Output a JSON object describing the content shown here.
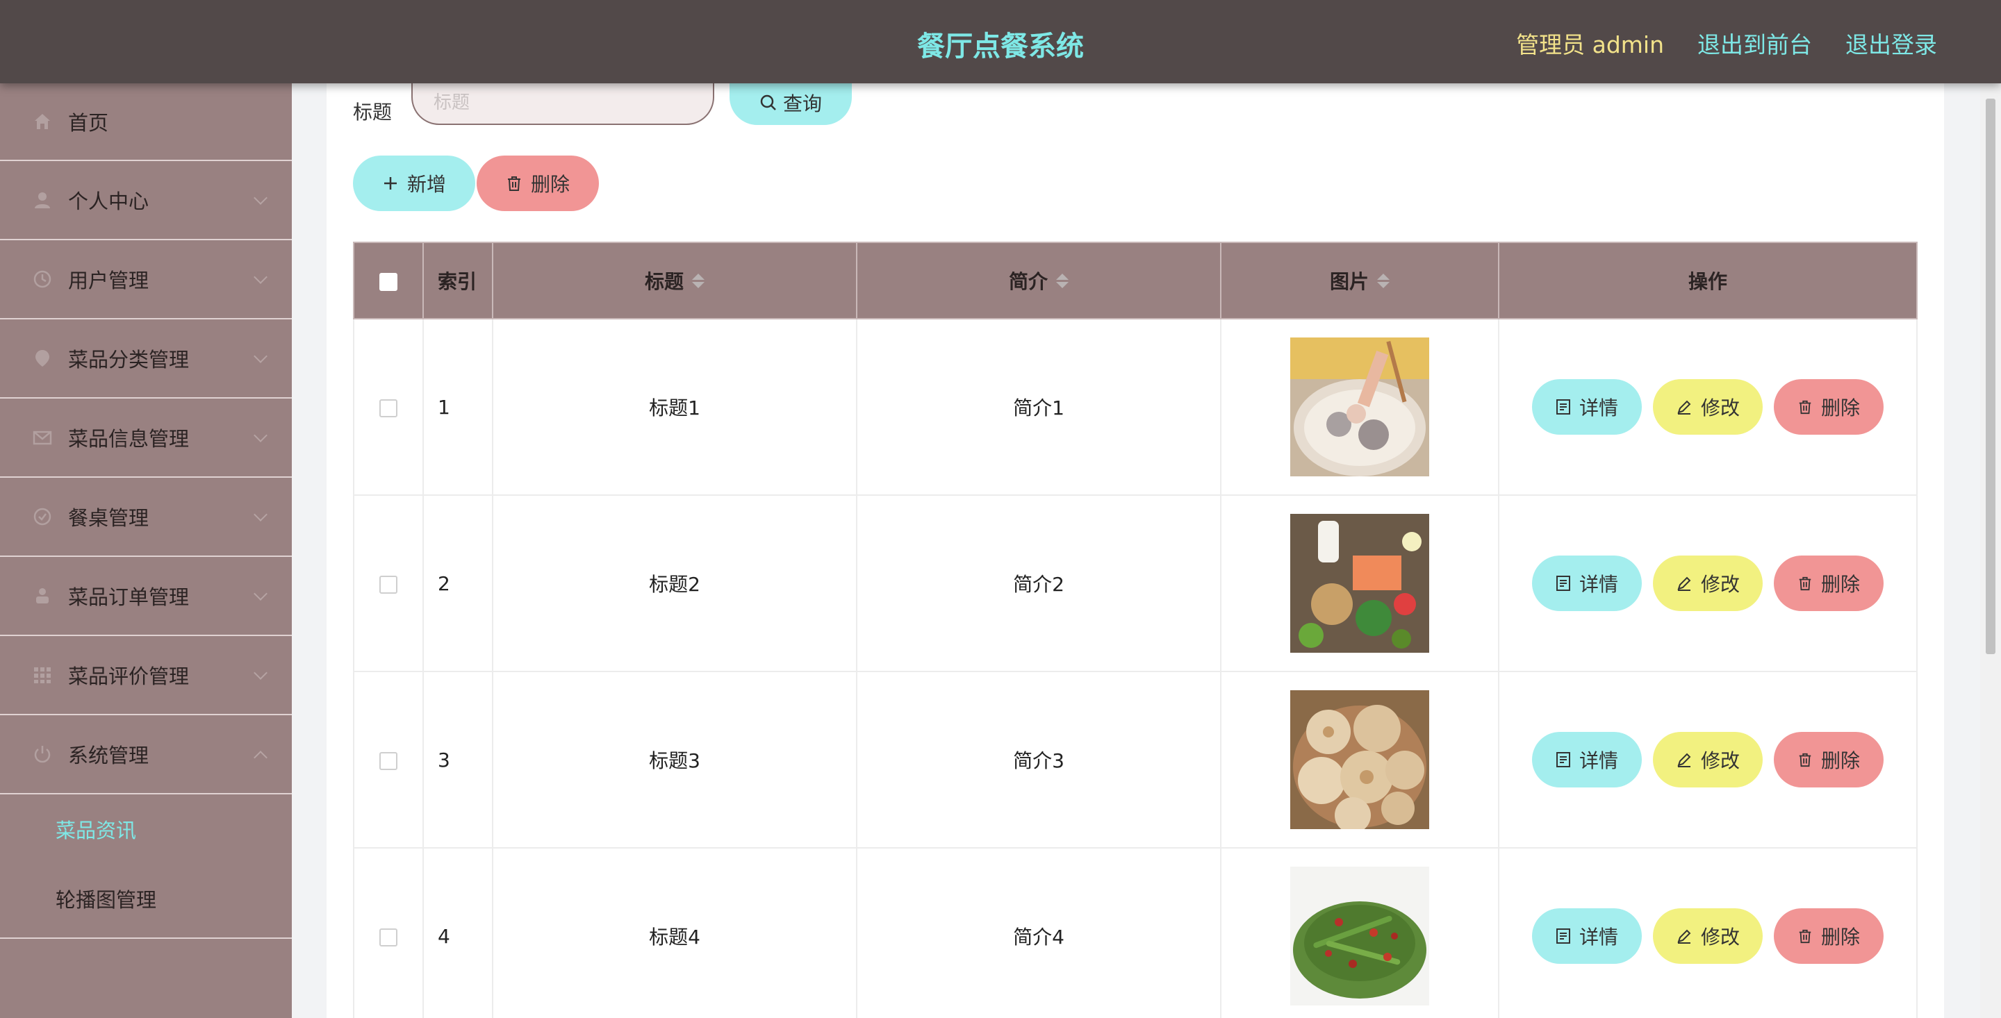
{
  "header": {
    "title": "餐厅点餐系统",
    "admin": "管理员 admin",
    "front_link": "退出到前台",
    "logout_link": "退出登录"
  },
  "sidebar": {
    "items": [
      {
        "label": "首页",
        "icon": "home-icon"
      },
      {
        "label": "个人中心",
        "icon": "user-icon"
      },
      {
        "label": "用户管理",
        "icon": "clock-icon"
      },
      {
        "label": "菜品分类管理",
        "icon": "location-icon"
      },
      {
        "label": "菜品信息管理",
        "icon": "mail-icon"
      },
      {
        "label": "餐桌管理",
        "icon": "check-circle-icon"
      },
      {
        "label": "菜品订单管理",
        "icon": "person-icon"
      },
      {
        "label": "菜品评价管理",
        "icon": "grid-icon"
      },
      {
        "label": "系统管理",
        "icon": "power-icon"
      }
    ],
    "submenu": [
      {
        "label": "菜品资讯",
        "active": true
      },
      {
        "label": "轮播图管理",
        "active": false
      }
    ]
  },
  "search": {
    "label": "标题",
    "placeholder": "标题",
    "button": "查询"
  },
  "actions": {
    "add": "新增",
    "delete": "删除"
  },
  "table": {
    "headers": {
      "index": "索引",
      "title": "标题",
      "intro": "简介",
      "image": "图片",
      "ops": "操作"
    },
    "rows": [
      {
        "index": "1",
        "title": "标题1",
        "intro": "简介1",
        "image": "hotpot-photo"
      },
      {
        "index": "2",
        "title": "标题2",
        "intro": "简介2",
        "image": "healthy-food-photo"
      },
      {
        "index": "3",
        "title": "标题3",
        "intro": "简介3",
        "image": "pastry-photo"
      },
      {
        "index": "4",
        "title": "标题4",
        "intro": "简介4",
        "image": "green-beans-photo"
      }
    ],
    "op_labels": {
      "detail": "详情",
      "edit": "修改",
      "delete": "删除"
    }
  },
  "colors": {
    "header_bg": "#524949",
    "sidebar_bg": "#998181",
    "accent_cyan": "#a4eeee",
    "accent_yellow": "#f2f180",
    "accent_red": "#f19595",
    "title_color": "#7ee8e6"
  }
}
